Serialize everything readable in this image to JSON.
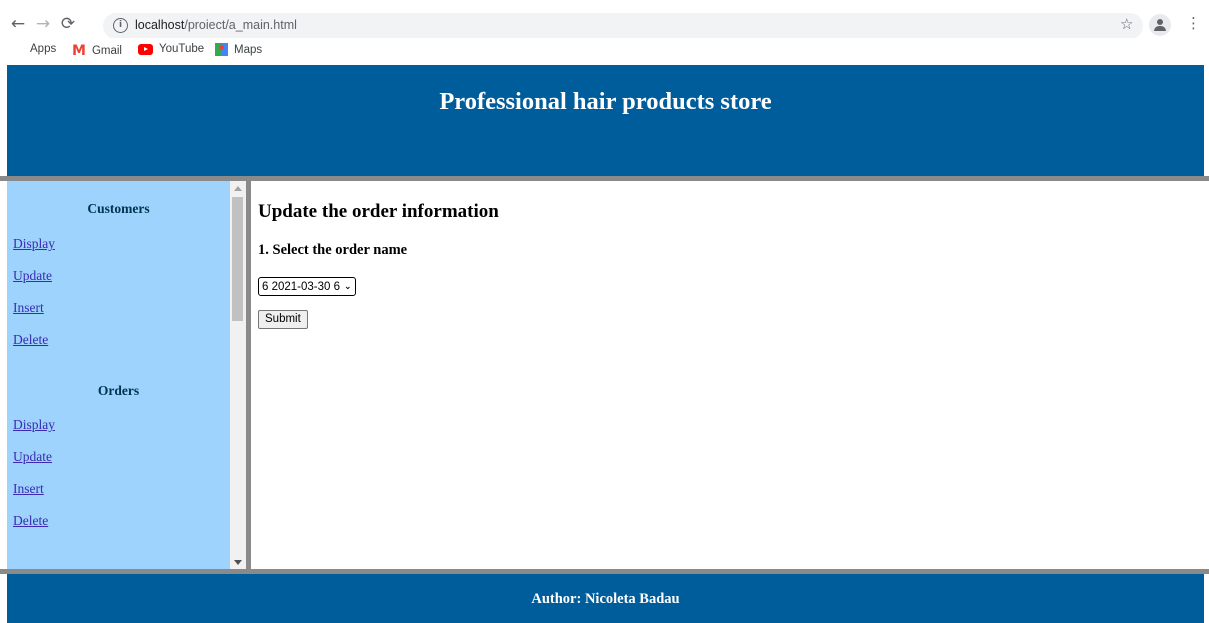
{
  "browser": {
    "url_host": "localhost",
    "url_path": "/proiect/a_main.html",
    "bookmarks": [
      {
        "label": "Apps"
      },
      {
        "label": "Gmail"
      },
      {
        "label": "YouTube"
      },
      {
        "label": "Maps"
      }
    ]
  },
  "header": {
    "title": "Professional hair products store"
  },
  "sidebar": {
    "sections": [
      {
        "heading": "Customers",
        "links": [
          "Display",
          "Update",
          "Insert",
          "Delete"
        ]
      },
      {
        "heading": "Orders",
        "links": [
          "Display",
          "Update",
          "Insert",
          "Delete"
        ]
      }
    ]
  },
  "main": {
    "title": "Update the order information",
    "step": "1. Select the order name",
    "select_value": "6 2021-03-30 6",
    "submit_label": "Submit"
  },
  "footer": {
    "author": "Author: Nicoleta Badau"
  },
  "colors": {
    "header_bg": "#005d9c",
    "sidebar_bg": "#9dd3fd",
    "link": "#3b2ab3"
  }
}
